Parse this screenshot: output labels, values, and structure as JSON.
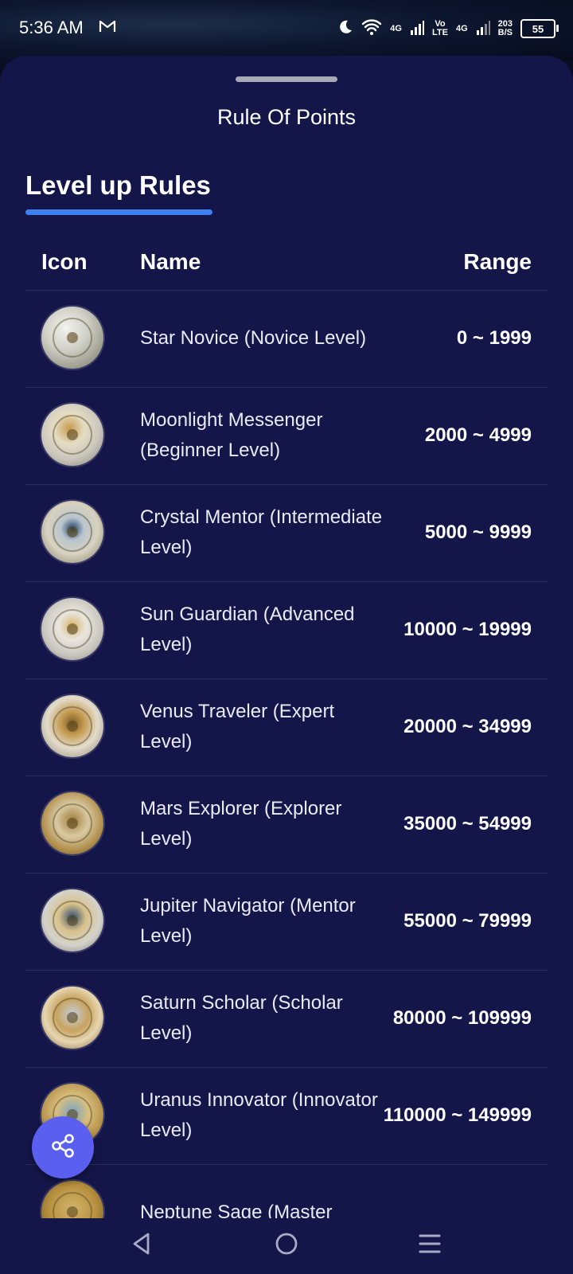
{
  "status_bar": {
    "time": "5:36 AM",
    "network_1": "4G",
    "volte_top": "Vo",
    "volte_bottom": "LTE",
    "network_2": "4G",
    "speed_value": "203",
    "speed_unit": "B/S",
    "battery": "55",
    "icons": [
      "gmail-icon",
      "moon-icon",
      "wifi-icon",
      "signal-icon",
      "battery-icon"
    ]
  },
  "sheet": {
    "title": "Rule Of Points",
    "section_title": "Level up Rules",
    "accent_color": "#3f7ff0"
  },
  "table": {
    "headers": {
      "icon": "Icon",
      "name": "Name",
      "range": "Range"
    },
    "rows": [
      {
        "name": "Star Novice (Novice Level)",
        "range": "0 ~ 1999",
        "icon": "star-novice-medal-icon"
      },
      {
        "name": "Moonlight Messenger (Beginner Level)",
        "range": "2000 ~ 4999",
        "icon": "moonlight-messenger-medal-icon"
      },
      {
        "name": "Crystal Mentor (Intermediate Level)",
        "range": "5000 ~ 9999",
        "icon": "crystal-mentor-medal-icon"
      },
      {
        "name": "Sun Guardian (Advanced Level)",
        "range": "10000 ~ 19999",
        "icon": "sun-guardian-medal-icon"
      },
      {
        "name": "Venus Traveler (Expert Level)",
        "range": "20000 ~ 34999",
        "icon": "venus-traveler-medal-icon"
      },
      {
        "name": "Mars Explorer (Explorer Level)",
        "range": "35000 ~ 54999",
        "icon": "mars-explorer-medal-icon"
      },
      {
        "name": "Jupiter Navigator (Mentor Level)",
        "range": "55000 ~ 79999",
        "icon": "jupiter-navigator-medal-icon"
      },
      {
        "name": "Saturn Scholar (Scholar Level)",
        "range": "80000 ~ 109999",
        "icon": "saturn-scholar-medal-icon"
      },
      {
        "name": "Uranus Innovator (Innovator Level)",
        "range": "110000 ~ 149999",
        "icon": "uranus-innovator-medal-icon"
      },
      {
        "name": "Neptune Sage (Master",
        "range": "",
        "icon": "neptune-sage-medal-icon"
      }
    ]
  },
  "fab": {
    "icon": "share-icon",
    "color": "#5b5ff0"
  },
  "nav": {
    "icons": [
      "back-icon",
      "home-icon",
      "menu-icon"
    ]
  }
}
